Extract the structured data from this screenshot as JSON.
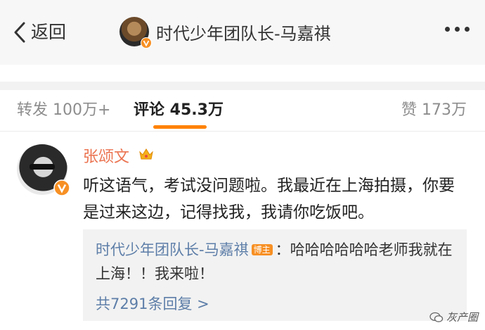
{
  "header": {
    "back_label": "返回",
    "title": "时代少年团队长-马嘉祺"
  },
  "tabs": [
    {
      "label": "转发 100万+"
    },
    {
      "label": "评论 45.3万"
    },
    {
      "label": "赞 173万"
    }
  ],
  "active_tab_index": 1,
  "comment": {
    "author": "张颂文",
    "text": "听这语气，考试没问题啦。我最近在上海拍摄，你要是过来这边，记得找我，我请你吃饭吧。",
    "reply": {
      "user": "时代少年团队长-马嘉祺",
      "badge": "博主",
      "text": "：哈哈哈哈哈哈老师我就在上海！！我来啦！"
    },
    "reply_count_label": "共7291条回复 >"
  },
  "watermark": "灰产圈",
  "colors": {
    "accent": "#ff8200",
    "username": "#eb7350",
    "link": "#5d7ea8",
    "verified": "#f79024"
  },
  "icons": {
    "back": "chevron-left-icon",
    "more": "more-dots-icon",
    "verified": "verified-v-icon",
    "crown": "crown-icon"
  }
}
